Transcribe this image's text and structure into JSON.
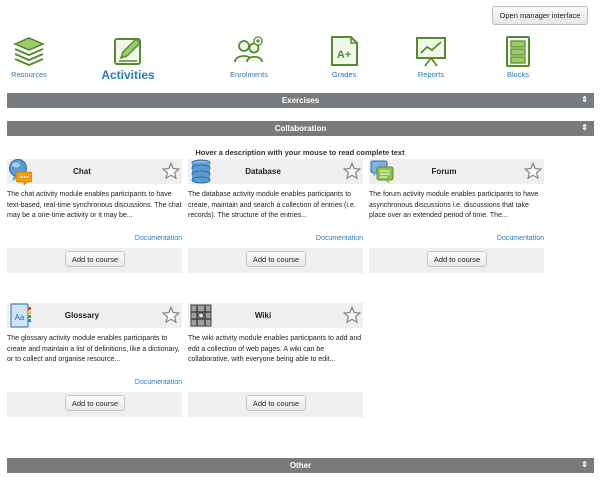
{
  "header": {
    "manager_button": "Open manager interface"
  },
  "nav": {
    "resources": "Resources",
    "activities": "Activities",
    "enrolments": "Enrolments",
    "grades": "Grades",
    "reports": "Reports",
    "blocks": "Blocks"
  },
  "sections": {
    "exercises": "Exercises",
    "collaboration": "Collaboration",
    "other": "Other",
    "toggle_symbol": "⇕"
  },
  "hover_note": "Hover a description with your mouse to read complete text",
  "common": {
    "documentation": "Documentation",
    "add_to_course": "Add to course"
  },
  "modules": [
    {
      "title": "Chat",
      "description": "The chat activity module enables participants to have text-based, real-time synchronous discussions. The chat may be a one-time activity or it may be..."
    },
    {
      "title": "Database",
      "description": "The database activity module enables participants to create, maintain and search a collection of entries (i.e. records). The structure of the entries..."
    },
    {
      "title": "Forum",
      "description": "The forum activity module enables participants to have asynchronous discussions i.e. discussions that take place over an extended period of time. The..."
    },
    {
      "title": "Glossary",
      "description": "The glossary activity module enables participants to create and maintain a list of definitions, like a dictionary, or to collect and organise resource..."
    },
    {
      "title": "Wiki",
      "description": "The wiki activity module enables participants to add and edit a collection of web pages. A wiki can be collaborative, with everyone being able to edit..."
    }
  ],
  "colors": {
    "accent_green": "#7cb342",
    "link_blue": "#2b79b8",
    "bar_gray": "#777b7e"
  }
}
